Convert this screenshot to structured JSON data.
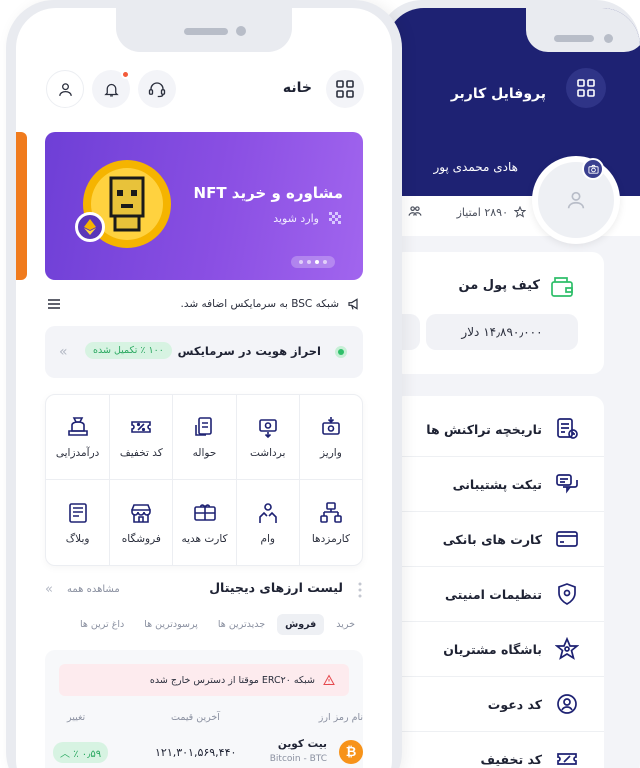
{
  "front": {
    "header": {
      "title": "خانه"
    },
    "banner": {
      "title": "مشاوره و خرید NFT",
      "subtitle": "وارد شوید",
      "accent": "#8a4fe3"
    },
    "announcement": "شبکه BSC به سرمایکس اضافه شد.",
    "kyc": {
      "title": "احراز هویت در سرمایکس",
      "badge": "۱۰۰ ٪ تکمیل شده"
    },
    "actions": [
      {
        "label": "واریز",
        "icon": "deposit-icon"
      },
      {
        "label": "برداشت",
        "icon": "withdraw-icon"
      },
      {
        "label": "حواله",
        "icon": "transfer-icon"
      },
      {
        "label": "کد تخفیف",
        "icon": "discount-code-icon"
      },
      {
        "label": "درآمدزایی",
        "icon": "earning-icon"
      },
      {
        "label": "کارمزدها",
        "icon": "fees-icon"
      },
      {
        "label": "وام",
        "icon": "loan-icon"
      },
      {
        "label": "کارت هدیه",
        "icon": "gift-card-icon"
      },
      {
        "label": "فروشگاه",
        "icon": "store-icon"
      },
      {
        "label": "وبلاگ",
        "icon": "blog-icon"
      }
    ],
    "crypto_list": {
      "title": "لیست ارزهای دیجیتال",
      "see_all": "مشاهده همه",
      "filters": [
        "خرید",
        "فروش",
        "جدیدترین ها",
        "پرسودترین ها",
        "داغ ترین ها"
      ],
      "active_filter": "فروش",
      "alert": "شبکه ERC۲۰ موقتا از دسترس خارج شده",
      "columns": {
        "name": "نام رمز ارز",
        "price": "آخرین قیمت",
        "change": "تغییر"
      },
      "rows": [
        {
          "name": "بیت کوین",
          "symbol": "Bitcoin - BTC",
          "price": "۱۲۱,۳۰۱,۵۶۹,۴۴۰",
          "change": "۰٫۵۹ ٪"
        }
      ]
    }
  },
  "back": {
    "header": {
      "title": "پروفایل کاربر",
      "name": "هادی محمدی پور",
      "color": "#1e2273"
    },
    "points": "۲۸۹۰ امتیاز",
    "wallet": {
      "title": "کیف پول من",
      "balance": "۱۴٫۸۹۰٫۰۰۰ دلار"
    },
    "menu": [
      {
        "label": "تاریخچه تراکنش ها",
        "icon": "transaction-history-icon"
      },
      {
        "label": "تیکت پشتیبانی",
        "icon": "support-ticket-icon"
      },
      {
        "label": "کارت های بانکی",
        "icon": "bank-card-icon"
      },
      {
        "label": "تنظیمات امنیتی",
        "icon": "security-shield-icon"
      },
      {
        "label": "باشگاه مشتریان",
        "icon": "customer-club-icon"
      },
      {
        "label": "کد دعوت",
        "icon": "invite-code-icon"
      },
      {
        "label": "کد تخفیف",
        "icon": "discount-icon"
      }
    ]
  }
}
